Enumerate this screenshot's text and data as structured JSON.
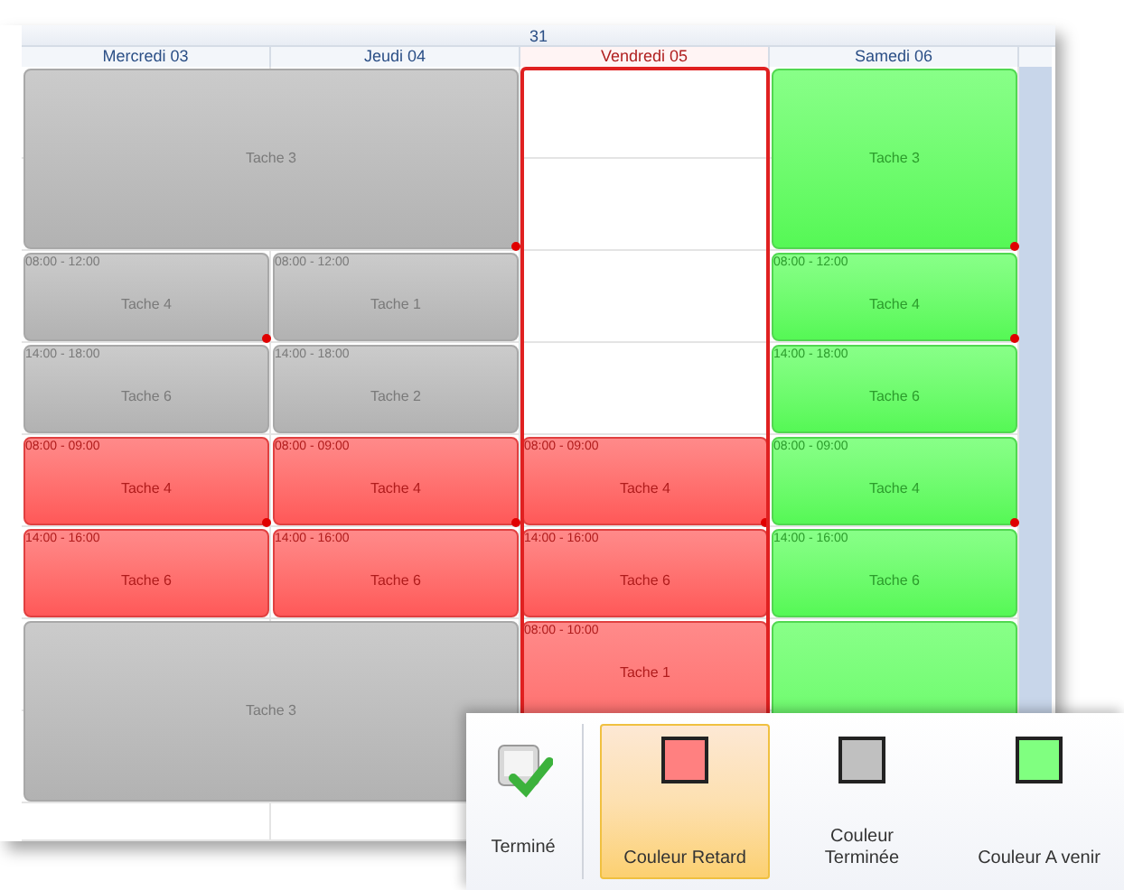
{
  "week": {
    "label": "31"
  },
  "days": [
    {
      "label": "Mercredi 03",
      "selected": false
    },
    {
      "label": "Jeudi 04",
      "selected": false
    },
    {
      "label": "Vendredi 05",
      "selected": true
    },
    {
      "label": "Samedi 06",
      "selected": false
    }
  ],
  "events": [
    {
      "kind": "done",
      "title": "Tache 3",
      "flag": true
    },
    {
      "kind": "upcoming",
      "title": "Tache 3",
      "flag": true
    },
    {
      "kind": "done",
      "time": "08:00 - 12:00",
      "title": "Tache 4",
      "flag": true
    },
    {
      "kind": "done",
      "time": "08:00 - 12:00",
      "title": "Tache 1",
      "flag": false
    },
    {
      "kind": "upcoming",
      "time": "08:00 - 12:00",
      "title": "Tache 4",
      "flag": true
    },
    {
      "kind": "done",
      "time": "14:00 - 18:00",
      "title": "Tache 6",
      "flag": false
    },
    {
      "kind": "done",
      "time": "14:00 - 18:00",
      "title": "Tache 2",
      "flag": false
    },
    {
      "kind": "upcoming",
      "time": "14:00 - 18:00",
      "title": "Tache 6",
      "flag": false
    },
    {
      "kind": "late",
      "time": "08:00 - 09:00",
      "title": "Tache 4",
      "flag": true
    },
    {
      "kind": "late",
      "time": "08:00 - 09:00",
      "title": "Tache 4",
      "flag": true
    },
    {
      "kind": "late",
      "time": "08:00 - 09:00",
      "title": "Tache 4",
      "flag": true
    },
    {
      "kind": "upcoming",
      "time": "08:00 - 09:00",
      "title": "Tache 4",
      "flag": true
    },
    {
      "kind": "late",
      "time": "14:00 - 16:00",
      "title": "Tache 6",
      "flag": false
    },
    {
      "kind": "late",
      "time": "14:00 - 16:00",
      "title": "Tache 6",
      "flag": false
    },
    {
      "kind": "late",
      "time": "14:00 - 16:00",
      "title": "Tache 6",
      "flag": false
    },
    {
      "kind": "upcoming",
      "time": "14:00 - 16:00",
      "title": "Tache 6",
      "flag": false
    },
    {
      "kind": "done",
      "title": "Tache 3",
      "flag": false
    },
    {
      "kind": "late",
      "time": "08:00 - 10:00",
      "title": "Tache 1",
      "flag": false
    },
    {
      "kind": "upcoming",
      "flag": false
    }
  ],
  "ribbon": {
    "toggle": {
      "label": "Terminé"
    },
    "colors": [
      {
        "label": "Couleur Retard",
        "color": "#ff8080",
        "selected": true
      },
      {
        "label": "Couleur Terminée",
        "color": "#c0c0c0",
        "selected": false
      },
      {
        "label": "Couleur A venir",
        "color": "#80ff80",
        "selected": false
      }
    ]
  }
}
